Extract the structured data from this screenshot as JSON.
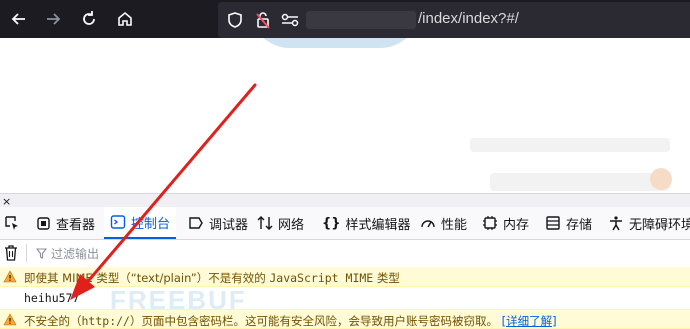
{
  "browser": {
    "url_suffix": "/index/index?#/"
  },
  "devtools": {
    "tabs": [
      {
        "label": "查看器",
        "icon": "inspector-icon"
      },
      {
        "label": "控制台",
        "icon": "console-icon"
      },
      {
        "label": "调试器",
        "icon": "debugger-icon"
      },
      {
        "label": "网络",
        "icon": "network-icon"
      },
      {
        "label": "样式编辑器",
        "icon": "style-editor-icon"
      },
      {
        "label": "性能",
        "icon": "performance-icon"
      },
      {
        "label": "内存",
        "icon": "memory-icon"
      },
      {
        "label": "存储",
        "icon": "storage-icon"
      },
      {
        "label": "无障碍环境",
        "icon": "accessibility-icon"
      }
    ],
    "active_tab": "控制台",
    "filter_placeholder": "过滤输出",
    "messages": {
      "warning1_prefix": "即使其 MIME 类型（“text/plain”）不是有效的 ",
      "warning1_code": "JavaScript MIME",
      "warning1_suffix": " 类型",
      "log_output": "heihu577",
      "warning2_prefix": "不安全的（",
      "warning2_code": "http://",
      "warning2_suffix": "）页面中包含密码栏。这可能有安全风险，会导致用户账号密码被窃取。",
      "warning2_link": "[详细了解]"
    }
  },
  "colors": {
    "toolbar_bg": "#1c1b22",
    "urlbar_bg": "#2b2a33",
    "accent_blue": "#0061e0",
    "warning_bg": "#fffbd6",
    "arrow_red": "#e0201b"
  },
  "watermark": "FREEBUF"
}
